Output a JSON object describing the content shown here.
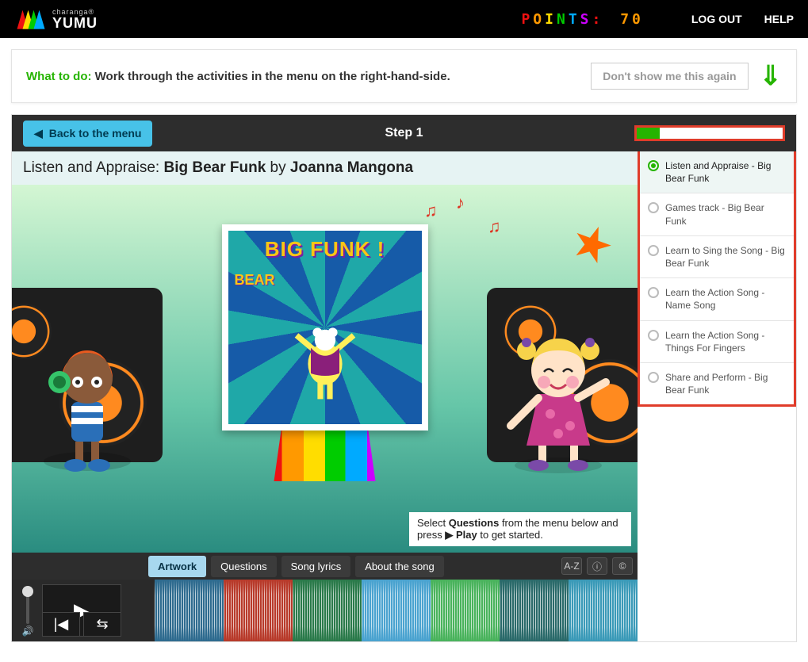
{
  "header": {
    "brand_sub": "charanga®",
    "brand_main": "YUMU",
    "points_label": "POINTS:",
    "points_value": "70",
    "logout": "LOG OUT",
    "help": "HELP"
  },
  "banner": {
    "prefix": "What to do:",
    "text": "Work through the activities in the menu on the right-hand-side.",
    "dismiss": "Don't show me this again"
  },
  "panel": {
    "back": "Back to the menu",
    "step": "Step 1",
    "progress_percent": 16
  },
  "title": {
    "prefix": "Listen and Appraise: ",
    "song": "Big Bear Funk",
    "by": " by ",
    "artist": "Joanna Mangona"
  },
  "album": {
    "line1": "BIG  FUNK !",
    "line2": "BEAR"
  },
  "tip": {
    "t1": "Select ",
    "t2": "Questions",
    "t3": " from the menu below and press ",
    "t4": "▶ Play",
    "t5": " to get started."
  },
  "tabs": [
    {
      "label": "Artwork",
      "active": true
    },
    {
      "label": "Questions",
      "active": false
    },
    {
      "label": "Song lyrics",
      "active": false
    },
    {
      "label": "About the song",
      "active": false
    }
  ],
  "tools": {
    "az": "A-Z",
    "info": "ⓘ",
    "copyright": "©"
  },
  "menu": [
    {
      "label": "Listen and Appraise - Big Bear Funk",
      "active": true
    },
    {
      "label": "Games track - Big Bear Funk",
      "active": false
    },
    {
      "label": "Learn to Sing the Song - Big Bear Funk",
      "active": false
    },
    {
      "label": "Learn the Action Song - Name Song",
      "active": false
    },
    {
      "label": "Learn the Action Song - Things For Fingers",
      "active": false
    },
    {
      "label": "Share and Perform - Big Bear Funk",
      "active": false
    }
  ]
}
